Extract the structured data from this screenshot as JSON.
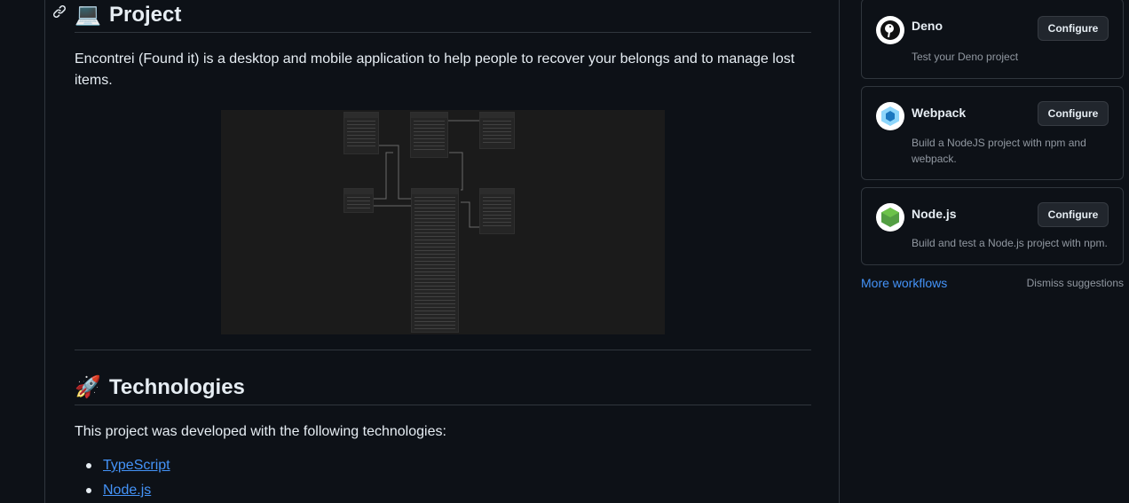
{
  "readme": {
    "project_emoji": "💻",
    "project_heading": "Project",
    "description": "Encontrei (Found it) is a desktop and mobile application to help people to recover your belongs and to manage lost items.",
    "tech_emoji": "🚀",
    "tech_heading": "Technologies",
    "tech_intro": "This project was developed with the following technologies:",
    "technologies": [
      "TypeScript",
      "Node.js"
    ]
  },
  "sidebar": {
    "workflows": [
      {
        "name": "Deno",
        "description": "Test your Deno project",
        "button": "Configure",
        "icon": "deno-icon"
      },
      {
        "name": "Webpack",
        "description": "Build a NodeJS project with npm and webpack.",
        "button": "Configure",
        "icon": "webpack-icon"
      },
      {
        "name": "Node.js",
        "description": "Build and test a Node.js project with npm.",
        "button": "Configure",
        "icon": "nodejs-icon"
      }
    ],
    "more_workflows": "More workflows",
    "dismiss": "Dismiss suggestions"
  },
  "colors": {
    "background": "#0d1117",
    "border": "#30363d",
    "link": "#4493f8",
    "muted": "#9198a1"
  }
}
